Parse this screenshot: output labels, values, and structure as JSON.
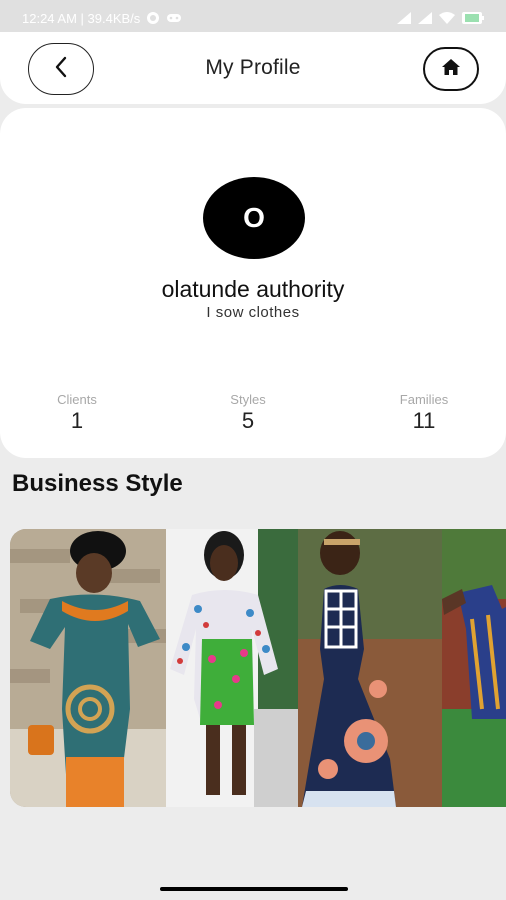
{
  "status_bar": {
    "time_speed": "12:24 AM | 39.4KB/s"
  },
  "header": {
    "title": "My Profile"
  },
  "profile": {
    "avatar_initial": "O",
    "name": "olatunde authority",
    "bio": "I sow clothes"
  },
  "stats": [
    {
      "label": "Clients",
      "value": "1"
    },
    {
      "label": "Styles",
      "value": "5"
    },
    {
      "label": "Families",
      "value": "11"
    }
  ],
  "section": {
    "title": "Business Style"
  },
  "colors": {
    "background": "#ececec",
    "card": "#ffffff",
    "avatar": "#000000",
    "muted_label": "#a8a8a8"
  },
  "icons": [
    "whatsapp-icon",
    "game-controller-icon",
    "signal-icon",
    "wifi-icon",
    "battery-icon",
    "back-arrow-icon",
    "home-icon"
  ]
}
